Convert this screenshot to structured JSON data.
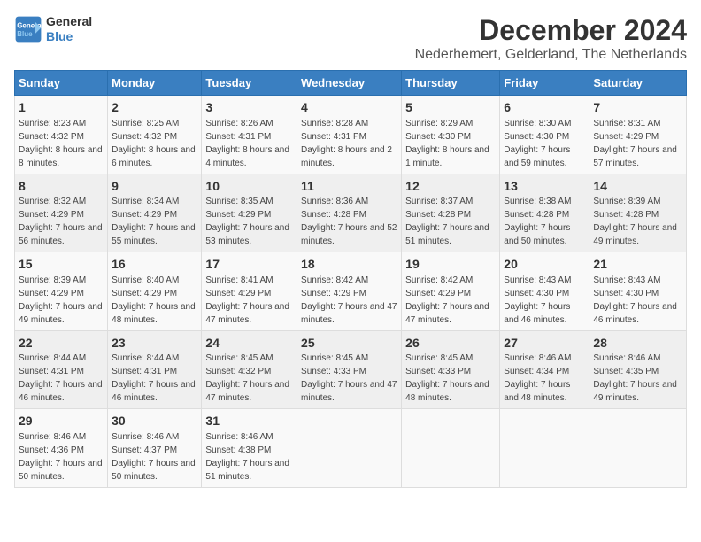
{
  "header": {
    "logo_line1": "General",
    "logo_line2": "Blue",
    "title": "December 2024",
    "subtitle": "Nederhemert, Gelderland, The Netherlands"
  },
  "days_of_week": [
    "Sunday",
    "Monday",
    "Tuesday",
    "Wednesday",
    "Thursday",
    "Friday",
    "Saturday"
  ],
  "weeks": [
    [
      {
        "day": "1",
        "sunrise": "Sunrise: 8:23 AM",
        "sunset": "Sunset: 4:32 PM",
        "daylight": "Daylight: 8 hours and 8 minutes."
      },
      {
        "day": "2",
        "sunrise": "Sunrise: 8:25 AM",
        "sunset": "Sunset: 4:32 PM",
        "daylight": "Daylight: 8 hours and 6 minutes."
      },
      {
        "day": "3",
        "sunrise": "Sunrise: 8:26 AM",
        "sunset": "Sunset: 4:31 PM",
        "daylight": "Daylight: 8 hours and 4 minutes."
      },
      {
        "day": "4",
        "sunrise": "Sunrise: 8:28 AM",
        "sunset": "Sunset: 4:31 PM",
        "daylight": "Daylight: 8 hours and 2 minutes."
      },
      {
        "day": "5",
        "sunrise": "Sunrise: 8:29 AM",
        "sunset": "Sunset: 4:30 PM",
        "daylight": "Daylight: 8 hours and 1 minute."
      },
      {
        "day": "6",
        "sunrise": "Sunrise: 8:30 AM",
        "sunset": "Sunset: 4:30 PM",
        "daylight": "Daylight: 7 hours and 59 minutes."
      },
      {
        "day": "7",
        "sunrise": "Sunrise: 8:31 AM",
        "sunset": "Sunset: 4:29 PM",
        "daylight": "Daylight: 7 hours and 57 minutes."
      }
    ],
    [
      {
        "day": "8",
        "sunrise": "Sunrise: 8:32 AM",
        "sunset": "Sunset: 4:29 PM",
        "daylight": "Daylight: 7 hours and 56 minutes."
      },
      {
        "day": "9",
        "sunrise": "Sunrise: 8:34 AM",
        "sunset": "Sunset: 4:29 PM",
        "daylight": "Daylight: 7 hours and 55 minutes."
      },
      {
        "day": "10",
        "sunrise": "Sunrise: 8:35 AM",
        "sunset": "Sunset: 4:29 PM",
        "daylight": "Daylight: 7 hours and 53 minutes."
      },
      {
        "day": "11",
        "sunrise": "Sunrise: 8:36 AM",
        "sunset": "Sunset: 4:28 PM",
        "daylight": "Daylight: 7 hours and 52 minutes."
      },
      {
        "day": "12",
        "sunrise": "Sunrise: 8:37 AM",
        "sunset": "Sunset: 4:28 PM",
        "daylight": "Daylight: 7 hours and 51 minutes."
      },
      {
        "day": "13",
        "sunrise": "Sunrise: 8:38 AM",
        "sunset": "Sunset: 4:28 PM",
        "daylight": "Daylight: 7 hours and 50 minutes."
      },
      {
        "day": "14",
        "sunrise": "Sunrise: 8:39 AM",
        "sunset": "Sunset: 4:28 PM",
        "daylight": "Daylight: 7 hours and 49 minutes."
      }
    ],
    [
      {
        "day": "15",
        "sunrise": "Sunrise: 8:39 AM",
        "sunset": "Sunset: 4:29 PM",
        "daylight": "Daylight: 7 hours and 49 minutes."
      },
      {
        "day": "16",
        "sunrise": "Sunrise: 8:40 AM",
        "sunset": "Sunset: 4:29 PM",
        "daylight": "Daylight: 7 hours and 48 minutes."
      },
      {
        "day": "17",
        "sunrise": "Sunrise: 8:41 AM",
        "sunset": "Sunset: 4:29 PM",
        "daylight": "Daylight: 7 hours and 47 minutes."
      },
      {
        "day": "18",
        "sunrise": "Sunrise: 8:42 AM",
        "sunset": "Sunset: 4:29 PM",
        "daylight": "Daylight: 7 hours and 47 minutes."
      },
      {
        "day": "19",
        "sunrise": "Sunrise: 8:42 AM",
        "sunset": "Sunset: 4:29 PM",
        "daylight": "Daylight: 7 hours and 47 minutes."
      },
      {
        "day": "20",
        "sunrise": "Sunrise: 8:43 AM",
        "sunset": "Sunset: 4:30 PM",
        "daylight": "Daylight: 7 hours and 46 minutes."
      },
      {
        "day": "21",
        "sunrise": "Sunrise: 8:43 AM",
        "sunset": "Sunset: 4:30 PM",
        "daylight": "Daylight: 7 hours and 46 minutes."
      }
    ],
    [
      {
        "day": "22",
        "sunrise": "Sunrise: 8:44 AM",
        "sunset": "Sunset: 4:31 PM",
        "daylight": "Daylight: 7 hours and 46 minutes."
      },
      {
        "day": "23",
        "sunrise": "Sunrise: 8:44 AM",
        "sunset": "Sunset: 4:31 PM",
        "daylight": "Daylight: 7 hours and 46 minutes."
      },
      {
        "day": "24",
        "sunrise": "Sunrise: 8:45 AM",
        "sunset": "Sunset: 4:32 PM",
        "daylight": "Daylight: 7 hours and 47 minutes."
      },
      {
        "day": "25",
        "sunrise": "Sunrise: 8:45 AM",
        "sunset": "Sunset: 4:33 PM",
        "daylight": "Daylight: 7 hours and 47 minutes."
      },
      {
        "day": "26",
        "sunrise": "Sunrise: 8:45 AM",
        "sunset": "Sunset: 4:33 PM",
        "daylight": "Daylight: 7 hours and 48 minutes."
      },
      {
        "day": "27",
        "sunrise": "Sunrise: 8:46 AM",
        "sunset": "Sunset: 4:34 PM",
        "daylight": "Daylight: 7 hours and 48 minutes."
      },
      {
        "day": "28",
        "sunrise": "Sunrise: 8:46 AM",
        "sunset": "Sunset: 4:35 PM",
        "daylight": "Daylight: 7 hours and 49 minutes."
      }
    ],
    [
      {
        "day": "29",
        "sunrise": "Sunrise: 8:46 AM",
        "sunset": "Sunset: 4:36 PM",
        "daylight": "Daylight: 7 hours and 50 minutes."
      },
      {
        "day": "30",
        "sunrise": "Sunrise: 8:46 AM",
        "sunset": "Sunset: 4:37 PM",
        "daylight": "Daylight: 7 hours and 50 minutes."
      },
      {
        "day": "31",
        "sunrise": "Sunrise: 8:46 AM",
        "sunset": "Sunset: 4:38 PM",
        "daylight": "Daylight: 7 hours and 51 minutes."
      },
      null,
      null,
      null,
      null
    ]
  ]
}
